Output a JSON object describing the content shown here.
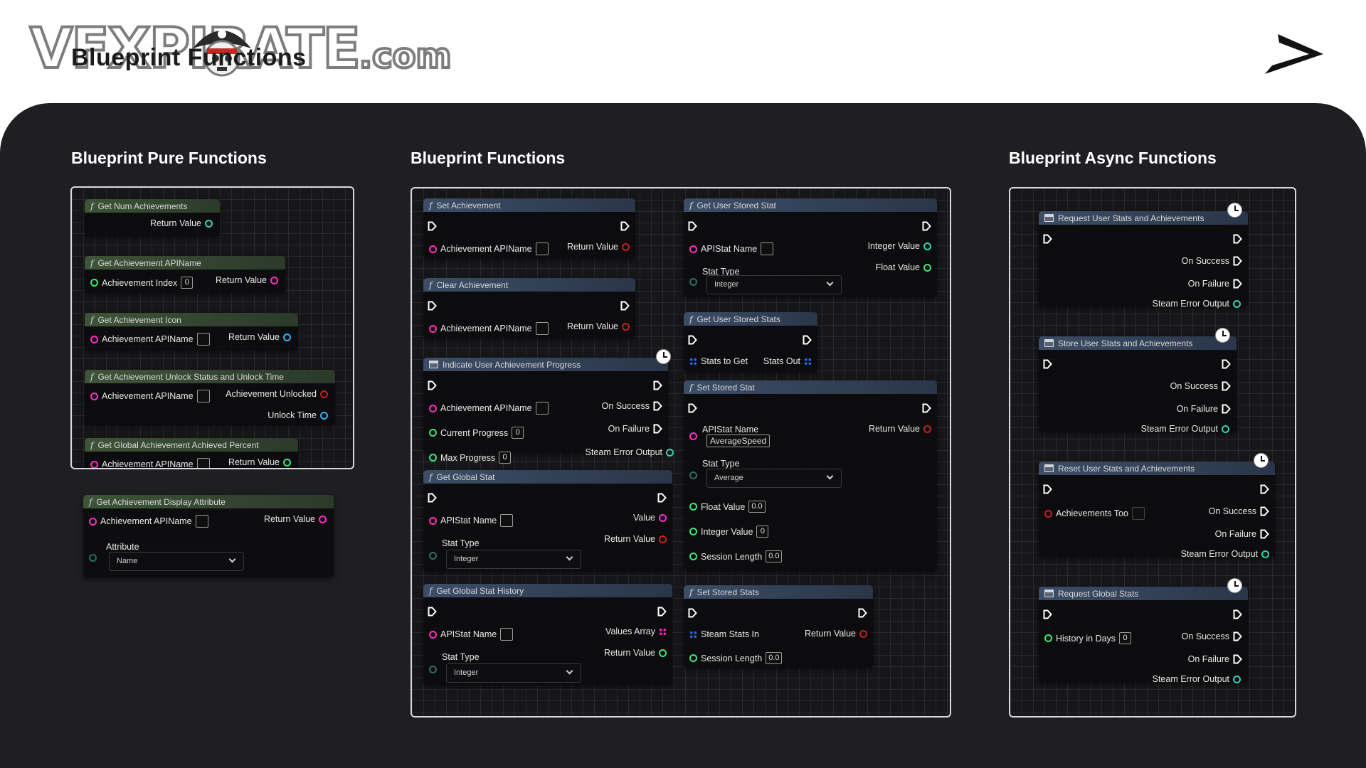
{
  "header": {
    "logo_text": "VFXPIRATE",
    "logo_suffix": ".com",
    "page_heading": "Blueprint Functions"
  },
  "sections": {
    "pure": "Blueprint Pure Functions",
    "functions": "Blueprint Functions",
    "async": "Blueprint Async Functions"
  },
  "pure_nodes": {
    "n1": {
      "title": "Get Num Achievements",
      "out": "Return Value"
    },
    "n2": {
      "title": "Get Achievement APIName",
      "in": "Achievement Index",
      "in_val": "0",
      "out": "Return Value"
    },
    "n3": {
      "title": "Get Achievement Icon",
      "in": "Achievement APIName",
      "out": "Return Value"
    },
    "n4": {
      "title": "Get Achievement Unlock Status and Unlock Time",
      "in": "Achievement APIName",
      "out1": "Achievement Unlocked",
      "out2": "Unlock Time"
    },
    "n5": {
      "title": "Get Global Achievement Achieved Percent",
      "in": "Achievement APIName",
      "out": "Return Value"
    },
    "n6": {
      "title": "Get Achievement Display Attribute",
      "in": "Achievement APIName",
      "out": "Return Value",
      "attr_label": "Attribute",
      "attr_value": "Name"
    }
  },
  "func_nodes": {
    "set_ach": {
      "title": "Set Achievement",
      "in": "Achievement APIName",
      "out": "Return Value"
    },
    "clear_ach": {
      "title": "Clear Achievement",
      "in": "Achievement APIName",
      "out": "Return Value"
    },
    "indicate": {
      "title": "Indicate User Achievement Progress",
      "in1": "Achievement APIName",
      "in2": "Current Progress",
      "in2_val": "0",
      "in3": "Max Progress",
      "in3_val": "0",
      "out1": "On Success",
      "out2": "On Failure",
      "out3": "Steam Error Output"
    },
    "global_stat": {
      "title": "Get Global Stat",
      "in": "APIStat Name",
      "stat_label": "Stat Type",
      "stat_value": "Integer",
      "out1": "Value",
      "out2": "Return Value"
    },
    "global_hist": {
      "title": "Get Global Stat History",
      "in": "APIStat Name",
      "stat_label": "Stat Type",
      "stat_value": "Integer",
      "out1": "Values Array",
      "out2": "Return Value"
    },
    "user_stat": {
      "title": "Get User Stored Stat",
      "in": "APIStat Name",
      "stat_label": "Stat Type",
      "stat_value": "Integer",
      "out1": "Integer Value",
      "out2": "Float Value"
    },
    "user_stats": {
      "title": "Get User Stored Stats",
      "in": "Stats to Get",
      "out": "Stats Out"
    },
    "set_stat": {
      "title": "Set Stored Stat",
      "in": "APIStat Name",
      "in_val": "AverageSpeed",
      "stat_label": "Stat Type",
      "stat_value": "Average",
      "f_label": "Float Value",
      "f_val": "0.0",
      "i_label": "Integer Value",
      "i_val": "0",
      "s_label": "Session Length",
      "s_val": "0.0",
      "out": "Return Value"
    },
    "set_stats": {
      "title": "Set Stored Stats",
      "in1": "Steam Stats In",
      "in2": "Session Length",
      "in2_val": "0.0",
      "out": "Return Value"
    }
  },
  "async_nodes": {
    "req": {
      "title": "Request User Stats and Achievements",
      "o1": "On Success",
      "o2": "On Failure",
      "o3": "Steam Error Output"
    },
    "store": {
      "title": "Store User Stats and Achievements",
      "o1": "On Success",
      "o2": "On Failure",
      "o3": "Steam Error Output"
    },
    "reset": {
      "title": "Reset User Stats and Achievements",
      "in": "Achievements Too",
      "o1": "On Success",
      "o2": "On Failure",
      "o3": "Steam Error Output"
    },
    "global": {
      "title": "Request Global Stats",
      "in": "History in Days",
      "in_val": "0",
      "o1": "On Success",
      "o2": "On Failure",
      "o3": "Steam Error Output"
    }
  },
  "colors": {
    "canvas": "#1f1f23",
    "pure_header": "#3e5438",
    "func_header": "#3c4d66",
    "string_pin": "#ff2ec4",
    "int_pin": "#3ce87a",
    "object_pin": "#2fb3ff",
    "bool_pin": "#c81e1e"
  }
}
